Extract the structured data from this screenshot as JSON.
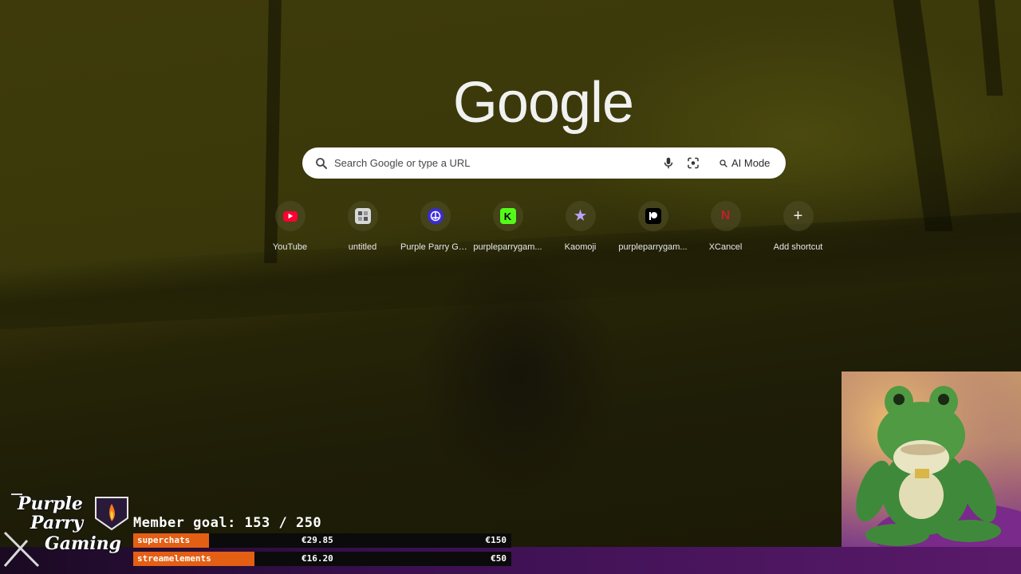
{
  "logo": {
    "text": "Google"
  },
  "search": {
    "placeholder": "Search Google or type a URL",
    "ai_mode_label": "AI Mode"
  },
  "shortcuts": [
    {
      "label": "YouTube",
      "icon": "youtube-icon",
      "color": "#ff0033"
    },
    {
      "label": "untitled",
      "icon": "document-icon",
      "color": "#cccccc"
    },
    {
      "label": "Purple Parry Ga...",
      "icon": "purple-parry-icon",
      "color": "#3a2bd8"
    },
    {
      "label": "purpleparrygam...",
      "icon": "kick-icon",
      "color": "#53fc18"
    },
    {
      "label": "Kaomoji",
      "icon": "kaomoji-icon",
      "color": "#8c7ad8"
    },
    {
      "label": "purpleparrygam...",
      "icon": "patreon-icon",
      "color": "#000000"
    },
    {
      "label": "XCancel",
      "icon": "xcancel-icon",
      "color": "#c0202a"
    },
    {
      "label": "Add shortcut",
      "icon": "plus-icon",
      "color": "#e8e8e8"
    }
  ],
  "overlay": {
    "brand": [
      "Purple",
      "Parry",
      "Gaming"
    ],
    "member_goal_label": "Member goal: 153 / 250",
    "bars": [
      {
        "name": "superchats",
        "amount": "€29.85",
        "target": "€150",
        "progress": 0.2
      },
      {
        "name": "streamelements",
        "amount": "€16.20",
        "target": "€50",
        "progress": 0.32
      }
    ],
    "accent": "#e35f14"
  }
}
